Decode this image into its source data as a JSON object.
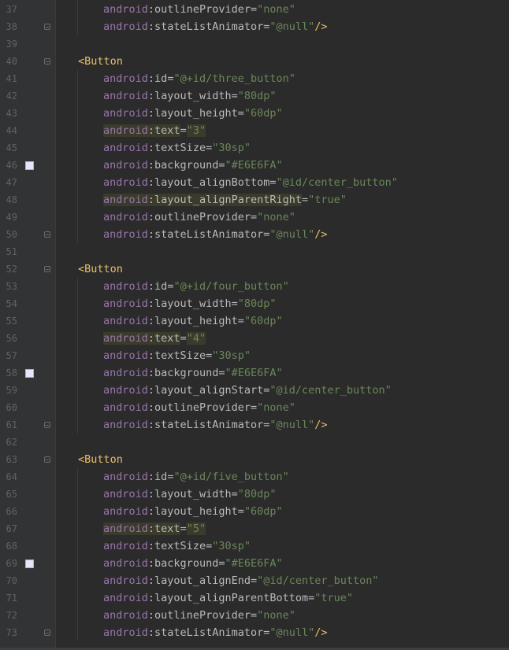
{
  "editor": {
    "lines": [
      {
        "n": "37",
        "type": "attr",
        "ns": "android",
        "attr": "outlineProvider",
        "value": "none"
      },
      {
        "n": "38",
        "type": "attr",
        "ns": "android",
        "attr": "stateListAnimator",
        "value": "@null",
        "close": "/>",
        "fold": true
      },
      {
        "n": "39",
        "type": "blank"
      },
      {
        "n": "40",
        "type": "tag",
        "tag": "<Button",
        "fold": true
      },
      {
        "n": "41",
        "type": "attr",
        "ns": "android",
        "attr": "id",
        "value": "@+id/three_button"
      },
      {
        "n": "42",
        "type": "attr",
        "ns": "android",
        "attr": "layout_width",
        "value": "80dp"
      },
      {
        "n": "43",
        "type": "attr",
        "ns": "android",
        "attr": "layout_height",
        "value": "60dp"
      },
      {
        "n": "44",
        "type": "attr",
        "ns": "android",
        "attr": "text",
        "value": "3",
        "highlight": true
      },
      {
        "n": "45",
        "type": "attr",
        "ns": "android",
        "attr": "textSize",
        "value": "30sp"
      },
      {
        "n": "46",
        "type": "attr",
        "ns": "android",
        "attr": "background",
        "value": "#E6E6FA",
        "swatch": "#E6E6FA"
      },
      {
        "n": "47",
        "type": "attr",
        "ns": "android",
        "attr": "layout_alignBottom",
        "value": "@id/center_button"
      },
      {
        "n": "48",
        "type": "attr",
        "ns": "android",
        "attr": "layout_alignParentRight",
        "value": "true",
        "highlight": true
      },
      {
        "n": "49",
        "type": "attr",
        "ns": "android",
        "attr": "outlineProvider",
        "value": "none"
      },
      {
        "n": "50",
        "type": "attr",
        "ns": "android",
        "attr": "stateListAnimator",
        "value": "@null",
        "close": "/>",
        "fold": true
      },
      {
        "n": "51",
        "type": "blank"
      },
      {
        "n": "52",
        "type": "tag",
        "tag": "<Button",
        "fold": true
      },
      {
        "n": "53",
        "type": "attr",
        "ns": "android",
        "attr": "id",
        "value": "@+id/four_button"
      },
      {
        "n": "54",
        "type": "attr",
        "ns": "android",
        "attr": "layout_width",
        "value": "80dp"
      },
      {
        "n": "55",
        "type": "attr",
        "ns": "android",
        "attr": "layout_height",
        "value": "60dp"
      },
      {
        "n": "56",
        "type": "attr",
        "ns": "android",
        "attr": "text",
        "value": "4",
        "highlight": true
      },
      {
        "n": "57",
        "type": "attr",
        "ns": "android",
        "attr": "textSize",
        "value": "30sp"
      },
      {
        "n": "58",
        "type": "attr",
        "ns": "android",
        "attr": "background",
        "value": "#E6E6FA",
        "swatch": "#E6E6FA"
      },
      {
        "n": "59",
        "type": "attr",
        "ns": "android",
        "attr": "layout_alignStart",
        "value": "@id/center_button"
      },
      {
        "n": "60",
        "type": "attr",
        "ns": "android",
        "attr": "outlineProvider",
        "value": "none"
      },
      {
        "n": "61",
        "type": "attr",
        "ns": "android",
        "attr": "stateListAnimator",
        "value": "@null",
        "close": "/>",
        "fold": true
      },
      {
        "n": "62",
        "type": "blank"
      },
      {
        "n": "63",
        "type": "tag",
        "tag": "<Button",
        "fold": true
      },
      {
        "n": "64",
        "type": "attr",
        "ns": "android",
        "attr": "id",
        "value": "@+id/five_button"
      },
      {
        "n": "65",
        "type": "attr",
        "ns": "android",
        "attr": "layout_width",
        "value": "80dp"
      },
      {
        "n": "66",
        "type": "attr",
        "ns": "android",
        "attr": "layout_height",
        "value": "60dp"
      },
      {
        "n": "67",
        "type": "attr",
        "ns": "android",
        "attr": "text",
        "value": "5",
        "highlight": true
      },
      {
        "n": "68",
        "type": "attr",
        "ns": "android",
        "attr": "textSize",
        "value": "30sp"
      },
      {
        "n": "69",
        "type": "attr",
        "ns": "android",
        "attr": "background",
        "value": "#E6E6FA",
        "swatch": "#E6E6FA"
      },
      {
        "n": "70",
        "type": "attr",
        "ns": "android",
        "attr": "layout_alignEnd",
        "value": "@id/center_button"
      },
      {
        "n": "71",
        "type": "attr",
        "ns": "android",
        "attr": "layout_alignParentBottom",
        "value": "true"
      },
      {
        "n": "72",
        "type": "attr",
        "ns": "android",
        "attr": "outlineProvider",
        "value": "none"
      },
      {
        "n": "73",
        "type": "attr",
        "ns": "android",
        "attr": "stateListAnimator",
        "value": "@null",
        "close": "/>",
        "fold": true
      }
    ]
  }
}
